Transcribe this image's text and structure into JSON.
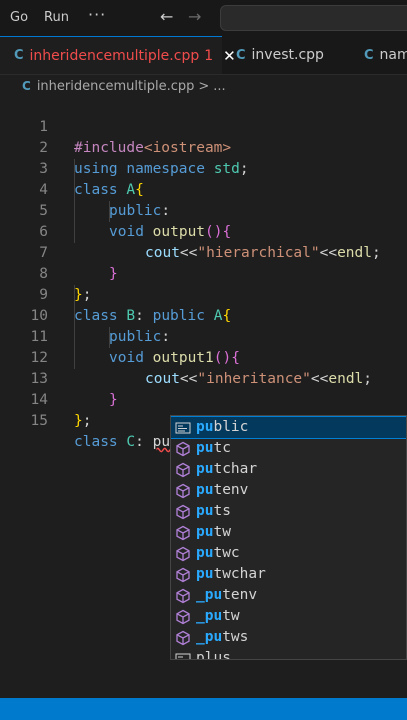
{
  "menu": {
    "go": "Go",
    "run": "Run",
    "more": "···"
  },
  "nav": {
    "back": "←",
    "forward": "→"
  },
  "tabs": [
    {
      "label": "inheridencemultiple.cpp",
      "badge": "1",
      "close": "✕",
      "icon": "C"
    },
    {
      "label": "invest.cpp",
      "icon": "C"
    },
    {
      "label": "nam",
      "icon": "C"
    }
  ],
  "breadcrumb": {
    "file": "inheridencemultiple.cpp",
    "sep": ">",
    "more": "..."
  },
  "code": {
    "line_numbers": [
      "1",
      "2",
      "3",
      "4",
      "5",
      "6",
      "7",
      "8",
      "9",
      "10",
      "11",
      "12",
      "13",
      "14",
      "15"
    ],
    "l1": {
      "a": "#include",
      "b": "<iostream>"
    },
    "l2": {
      "a": "using",
      "b": " ",
      "c": "namespace",
      "d": " ",
      "e": "std",
      "f": ";"
    },
    "l3": {
      "a": "class",
      "b": " ",
      "c": "A",
      "d": "{"
    },
    "l4": {
      "a": "public",
      "b": ":"
    },
    "l5": {
      "a": "void",
      "b": " ",
      "c": "output",
      "d": "(",
      "e": ")",
      "f": "{"
    },
    "l6": {
      "a": "cout",
      "b": "<<",
      "c": "\"hierarchical\"",
      "d": "<<",
      "e": "endl",
      "f": ";"
    },
    "l7": {
      "a": "}"
    },
    "l8": {
      "a": "}",
      "b": ";"
    },
    "l9": {
      "a": "class",
      "b": " ",
      "c": "B",
      "d": ": ",
      "e": "public",
      "f": " ",
      "g": "A",
      "h": "{"
    },
    "l10": {
      "a": "public",
      "b": ":"
    },
    "l11": {
      "a": "void",
      "b": " ",
      "c": "output1",
      "d": "(",
      "e": ")",
      "f": "{"
    },
    "l12": {
      "a": "cout",
      "b": "<<",
      "c": "\"inheritance\"",
      "d": "<<",
      "e": "endl",
      "f": ";"
    },
    "l13": {
      "a": "}"
    },
    "l14": {
      "a": "}",
      "b": ";"
    },
    "l15": {
      "a": "class",
      "b": " ",
      "c": "C",
      "d": ": ",
      "e": "pu"
    }
  },
  "suggestions": [
    {
      "match": "pu",
      "rest": "blic",
      "kind": "keyword-icon"
    },
    {
      "match": "pu",
      "rest": "tc",
      "kind": "function-icon"
    },
    {
      "match": "pu",
      "rest": "tchar",
      "kind": "function-icon"
    },
    {
      "match": "pu",
      "rest": "tenv",
      "kind": "function-icon"
    },
    {
      "match": "pu",
      "rest": "ts",
      "kind": "function-icon"
    },
    {
      "match": "pu",
      "rest": "tw",
      "kind": "function-icon"
    },
    {
      "match": "pu",
      "rest": "twc",
      "kind": "function-icon"
    },
    {
      "match": "pu",
      "rest": "twchar",
      "kind": "function-icon"
    },
    {
      "match": "_pu",
      "rest": "tenv",
      "kind": "function-icon"
    },
    {
      "match": "_pu",
      "rest": "tw",
      "kind": "function-icon"
    },
    {
      "match": "_pu",
      "rest": "tws",
      "kind": "function-icon"
    },
    {
      "match": "plus",
      "rest": "",
      "kind": "keyword-icon"
    }
  ],
  "colors": {
    "editor_bg": "#1e1e1e",
    "accent": "#007acc",
    "error": "#f14c4c",
    "keyword": "#569cd6",
    "type": "#4ec9b0",
    "function": "#dcdcaa",
    "string": "#ce9178",
    "match_highlight": "#2aaaff"
  }
}
